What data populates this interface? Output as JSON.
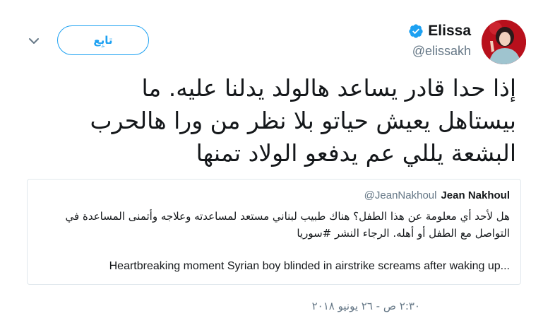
{
  "author": {
    "display_name": "Elissa",
    "handle": "@elissakh",
    "verified_icon": "verified-badge-icon",
    "avatar_description_icon": "avatar"
  },
  "actions": {
    "follow_label": "تابِع",
    "caret_icon": "chevron-down-icon"
  },
  "tweet": {
    "text": "إذا حدا قادر يساعد هالولد يدلنا عليه. ما\nبيستاهل يعيش حياتو بلا نظر من ورا هالحرب\nالبشعة يللي عم يدفعو الولاد تمنها",
    "timestamp": "٢:٣٠ ص - ٢٦ يونيو ٢٠١٨"
  },
  "quoted_tweet": {
    "name": "Jean Nakhoul",
    "handle": "@JeanNakhoul",
    "text": "هل لأحد أي معلومة عن هذا الطفل؟ هناك طبيب لبناني مستعد لمساعدته وعلاجه وأتمنى المساعدة في التواصل مع الطفل أو أهله. الرجاء النشر #سوريا",
    "link_text": "Heartbreaking moment Syrian boy blinded in airstrike screams after waking up..."
  },
  "colors": {
    "accent": "#1da1f2",
    "text": "#14171a",
    "muted": "#657786",
    "border": "#e1e8ed"
  }
}
